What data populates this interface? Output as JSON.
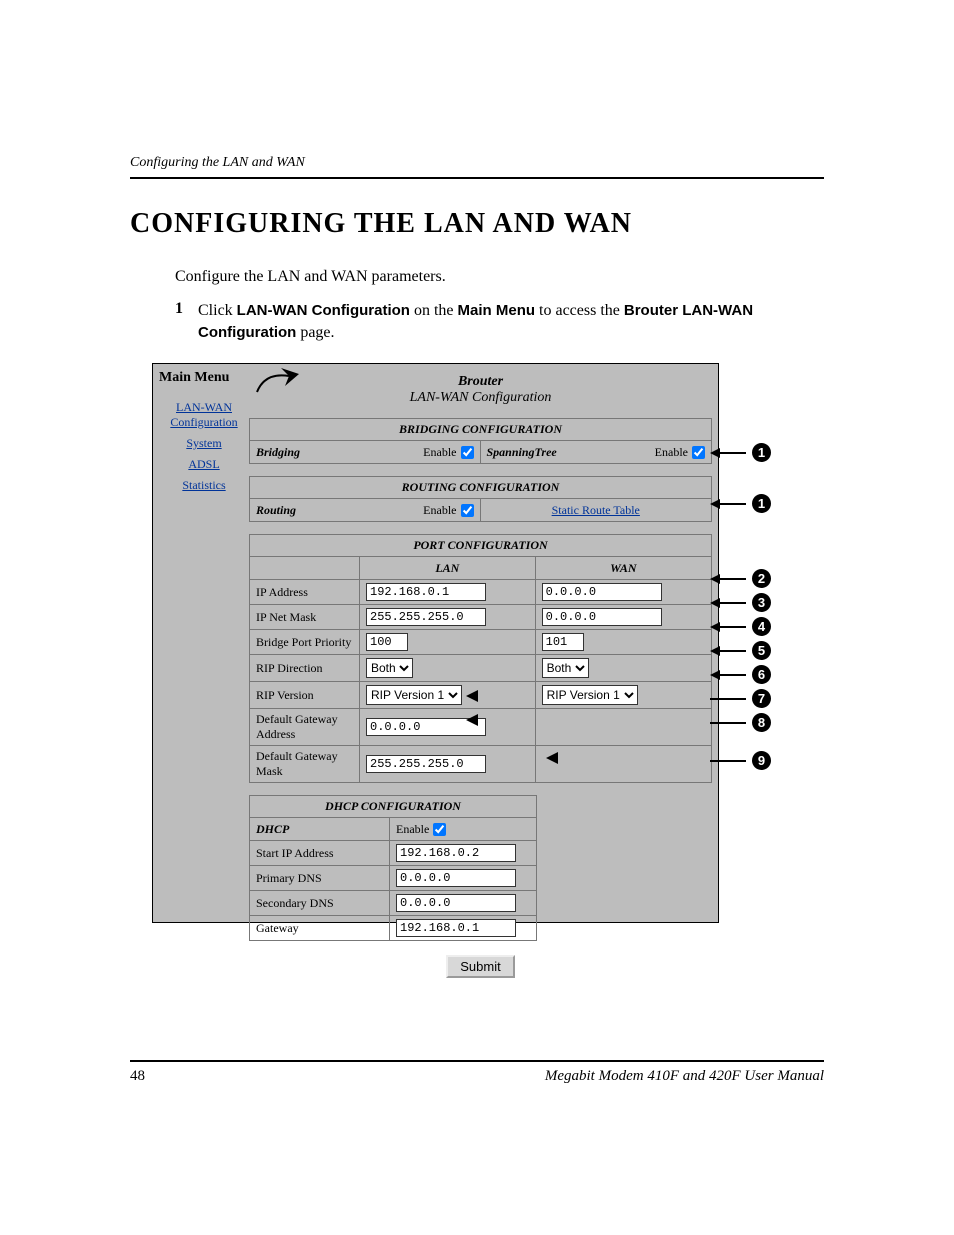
{
  "running_head": "Configuring the LAN and WAN",
  "heading": "CONFIGURING THE LAN AND WAN",
  "intro": "Configure the LAN and WAN parameters.",
  "step": {
    "num": "1",
    "pre": "Click ",
    "b1": "LAN-WAN Configuration",
    "mid1": " on the ",
    "b2": "Main Menu",
    "mid2": " to access the ",
    "b3": "Brouter LAN-WAN Configuration",
    "post": " page."
  },
  "menu": {
    "title": "Main Menu",
    "items": [
      "LAN-WAN Configuration",
      "System",
      "ADSL",
      "Statistics"
    ]
  },
  "screen": {
    "title1": "Brouter",
    "title2": "LAN-WAN Configuration",
    "bridging_section": "BRIDGING CONFIGURATION",
    "bridging_label": "Bridging",
    "enable_label": "Enable",
    "spanning_label": "SpanningTree",
    "routing_section": "ROUTING CONFIGURATION",
    "routing_label": "Routing",
    "static_route_link": "Static Route Table",
    "port_section": "PORT CONFIGURATION",
    "lan_col": "LAN",
    "wan_col": "WAN",
    "rows": {
      "ip_addr": {
        "label": "IP Address",
        "lan": "192.168.0.1",
        "wan": "0.0.0.0"
      },
      "netmask": {
        "label": "IP Net Mask",
        "lan": "255.255.255.0",
        "wan": "0.0.0.0"
      },
      "bpp": {
        "label": "Bridge Port Priority",
        "lan": "100",
        "wan": "101"
      },
      "rip_dir": {
        "label": "RIP Direction",
        "lan": "Both",
        "wan": "Both"
      },
      "rip_ver": {
        "label": "RIP Version",
        "lan": "RIP Version 1",
        "wan": "RIP Version 1"
      },
      "gw_addr": {
        "label": "Default Gateway Address",
        "val": "0.0.0.0"
      },
      "gw_mask": {
        "label": "Default Gateway Mask",
        "val": "255.255.255.0"
      }
    },
    "dhcp_section": "DHCP CONFIGURATION",
    "dhcp": {
      "label": "DHCP",
      "start": {
        "label": "Start IP Address",
        "val": "192.168.0.2"
      },
      "pdns": {
        "label": "Primary DNS",
        "val": "0.0.0.0"
      },
      "sdns": {
        "label": "Secondary DNS",
        "val": "0.0.0.0"
      },
      "gw": {
        "label": "Gateway",
        "val": "192.168.0.1"
      }
    },
    "submit": "Submit"
  },
  "callouts": [
    "1",
    "1",
    "2",
    "3",
    "4",
    "5",
    "6",
    "7",
    "8",
    "9"
  ],
  "footer": {
    "page": "48",
    "title": "Megabit Modem 410F and 420F User Manual"
  }
}
